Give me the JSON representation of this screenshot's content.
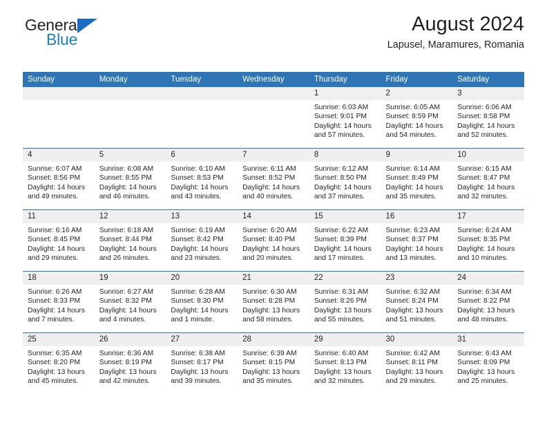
{
  "brand": {
    "name_part1": "General",
    "name_part2": "Blue"
  },
  "header": {
    "title": "August 2024",
    "location": "Lapusel, Maramures, Romania"
  },
  "calendar": {
    "weekday_headers": [
      "Sunday",
      "Monday",
      "Tuesday",
      "Wednesday",
      "Thursday",
      "Friday",
      "Saturday"
    ],
    "colors": {
      "header_blue": "#2e75b6",
      "daynum_gray": "#efefef",
      "brand_blue": "#1b7fc4",
      "text": "#231f20"
    },
    "labels": {
      "sunrise": "Sunrise:",
      "sunset": "Sunset:",
      "daylight": "Daylight:"
    },
    "weeks": [
      [
        {
          "day": "",
          "empty": true
        },
        {
          "day": "",
          "empty": true
        },
        {
          "day": "",
          "empty": true
        },
        {
          "day": "",
          "empty": true
        },
        {
          "day": "1",
          "sunrise": "Sunrise: 6:03 AM",
          "sunset": "Sunset: 9:01 PM",
          "daylight_line1": "Daylight: 14 hours",
          "daylight_line2": "and 57 minutes."
        },
        {
          "day": "2",
          "sunrise": "Sunrise: 6:05 AM",
          "sunset": "Sunset: 8:59 PM",
          "daylight_line1": "Daylight: 14 hours",
          "daylight_line2": "and 54 minutes."
        },
        {
          "day": "3",
          "sunrise": "Sunrise: 6:06 AM",
          "sunset": "Sunset: 8:58 PM",
          "daylight_line1": "Daylight: 14 hours",
          "daylight_line2": "and 52 minutes."
        }
      ],
      [
        {
          "day": "4",
          "sunrise": "Sunrise: 6:07 AM",
          "sunset": "Sunset: 8:56 PM",
          "daylight_line1": "Daylight: 14 hours",
          "daylight_line2": "and 49 minutes."
        },
        {
          "day": "5",
          "sunrise": "Sunrise: 6:08 AM",
          "sunset": "Sunset: 8:55 PM",
          "daylight_line1": "Daylight: 14 hours",
          "daylight_line2": "and 46 minutes."
        },
        {
          "day": "6",
          "sunrise": "Sunrise: 6:10 AM",
          "sunset": "Sunset: 8:53 PM",
          "daylight_line1": "Daylight: 14 hours",
          "daylight_line2": "and 43 minutes."
        },
        {
          "day": "7",
          "sunrise": "Sunrise: 6:11 AM",
          "sunset": "Sunset: 8:52 PM",
          "daylight_line1": "Daylight: 14 hours",
          "daylight_line2": "and 40 minutes."
        },
        {
          "day": "8",
          "sunrise": "Sunrise: 6:12 AM",
          "sunset": "Sunset: 8:50 PM",
          "daylight_line1": "Daylight: 14 hours",
          "daylight_line2": "and 37 minutes."
        },
        {
          "day": "9",
          "sunrise": "Sunrise: 6:14 AM",
          "sunset": "Sunset: 8:49 PM",
          "daylight_line1": "Daylight: 14 hours",
          "daylight_line2": "and 35 minutes."
        },
        {
          "day": "10",
          "sunrise": "Sunrise: 6:15 AM",
          "sunset": "Sunset: 8:47 PM",
          "daylight_line1": "Daylight: 14 hours",
          "daylight_line2": "and 32 minutes."
        }
      ],
      [
        {
          "day": "11",
          "sunrise": "Sunrise: 6:16 AM",
          "sunset": "Sunset: 8:45 PM",
          "daylight_line1": "Daylight: 14 hours",
          "daylight_line2": "and 29 minutes."
        },
        {
          "day": "12",
          "sunrise": "Sunrise: 6:18 AM",
          "sunset": "Sunset: 8:44 PM",
          "daylight_line1": "Daylight: 14 hours",
          "daylight_line2": "and 26 minutes."
        },
        {
          "day": "13",
          "sunrise": "Sunrise: 6:19 AM",
          "sunset": "Sunset: 8:42 PM",
          "daylight_line1": "Daylight: 14 hours",
          "daylight_line2": "and 23 minutes."
        },
        {
          "day": "14",
          "sunrise": "Sunrise: 6:20 AM",
          "sunset": "Sunset: 8:40 PM",
          "daylight_line1": "Daylight: 14 hours",
          "daylight_line2": "and 20 minutes."
        },
        {
          "day": "15",
          "sunrise": "Sunrise: 6:22 AM",
          "sunset": "Sunset: 8:39 PM",
          "daylight_line1": "Daylight: 14 hours",
          "daylight_line2": "and 17 minutes."
        },
        {
          "day": "16",
          "sunrise": "Sunrise: 6:23 AM",
          "sunset": "Sunset: 8:37 PM",
          "daylight_line1": "Daylight: 14 hours",
          "daylight_line2": "and 13 minutes."
        },
        {
          "day": "17",
          "sunrise": "Sunrise: 6:24 AM",
          "sunset": "Sunset: 8:35 PM",
          "daylight_line1": "Daylight: 14 hours",
          "daylight_line2": "and 10 minutes."
        }
      ],
      [
        {
          "day": "18",
          "sunrise": "Sunrise: 6:26 AM",
          "sunset": "Sunset: 8:33 PM",
          "daylight_line1": "Daylight: 14 hours",
          "daylight_line2": "and 7 minutes."
        },
        {
          "day": "19",
          "sunrise": "Sunrise: 6:27 AM",
          "sunset": "Sunset: 8:32 PM",
          "daylight_line1": "Daylight: 14 hours",
          "daylight_line2": "and 4 minutes."
        },
        {
          "day": "20",
          "sunrise": "Sunrise: 6:28 AM",
          "sunset": "Sunset: 8:30 PM",
          "daylight_line1": "Daylight: 14 hours",
          "daylight_line2": "and 1 minute."
        },
        {
          "day": "21",
          "sunrise": "Sunrise: 6:30 AM",
          "sunset": "Sunset: 8:28 PM",
          "daylight_line1": "Daylight: 13 hours",
          "daylight_line2": "and 58 minutes."
        },
        {
          "day": "22",
          "sunrise": "Sunrise: 6:31 AM",
          "sunset": "Sunset: 8:26 PM",
          "daylight_line1": "Daylight: 13 hours",
          "daylight_line2": "and 55 minutes."
        },
        {
          "day": "23",
          "sunrise": "Sunrise: 6:32 AM",
          "sunset": "Sunset: 8:24 PM",
          "daylight_line1": "Daylight: 13 hours",
          "daylight_line2": "and 51 minutes."
        },
        {
          "day": "24",
          "sunrise": "Sunrise: 6:34 AM",
          "sunset": "Sunset: 8:22 PM",
          "daylight_line1": "Daylight: 13 hours",
          "daylight_line2": "and 48 minutes."
        }
      ],
      [
        {
          "day": "25",
          "sunrise": "Sunrise: 6:35 AM",
          "sunset": "Sunset: 8:20 PM",
          "daylight_line1": "Daylight: 13 hours",
          "daylight_line2": "and 45 minutes."
        },
        {
          "day": "26",
          "sunrise": "Sunrise: 6:36 AM",
          "sunset": "Sunset: 8:19 PM",
          "daylight_line1": "Daylight: 13 hours",
          "daylight_line2": "and 42 minutes."
        },
        {
          "day": "27",
          "sunrise": "Sunrise: 6:38 AM",
          "sunset": "Sunset: 8:17 PM",
          "daylight_line1": "Daylight: 13 hours",
          "daylight_line2": "and 39 minutes."
        },
        {
          "day": "28",
          "sunrise": "Sunrise: 6:39 AM",
          "sunset": "Sunset: 8:15 PM",
          "daylight_line1": "Daylight: 13 hours",
          "daylight_line2": "and 35 minutes."
        },
        {
          "day": "29",
          "sunrise": "Sunrise: 6:40 AM",
          "sunset": "Sunset: 8:13 PM",
          "daylight_line1": "Daylight: 13 hours",
          "daylight_line2": "and 32 minutes."
        },
        {
          "day": "30",
          "sunrise": "Sunrise: 6:42 AM",
          "sunset": "Sunset: 8:11 PM",
          "daylight_line1": "Daylight: 13 hours",
          "daylight_line2": "and 29 minutes."
        },
        {
          "day": "31",
          "sunrise": "Sunrise: 6:43 AM",
          "sunset": "Sunset: 8:09 PM",
          "daylight_line1": "Daylight: 13 hours",
          "daylight_line2": "and 25 minutes."
        }
      ]
    ]
  }
}
